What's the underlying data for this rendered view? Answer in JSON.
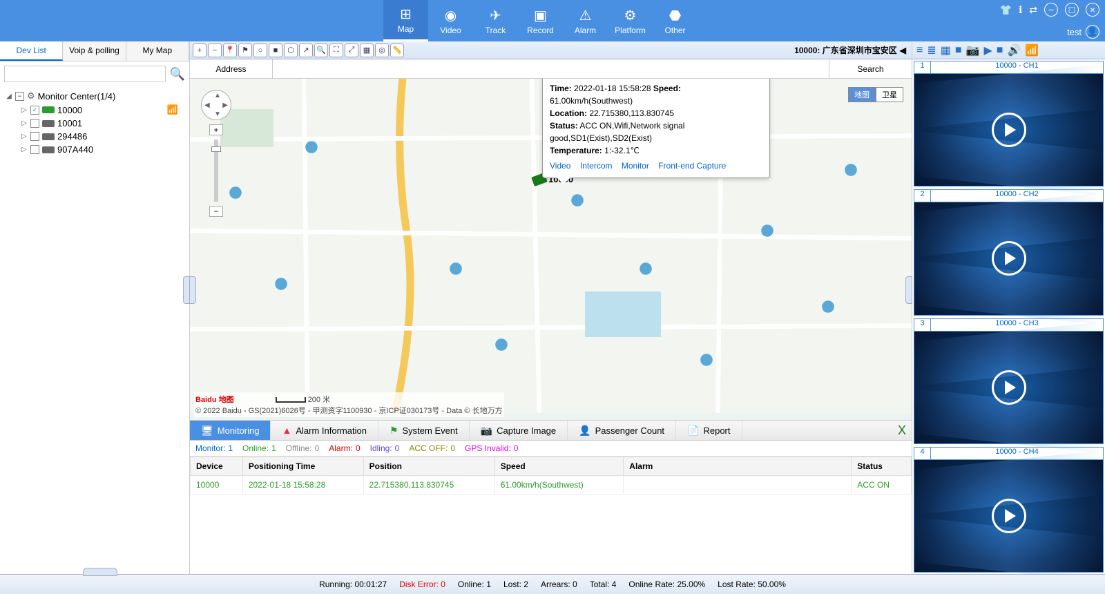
{
  "nav": {
    "tabs": [
      {
        "label": "Map",
        "active": true
      },
      {
        "label": "Video"
      },
      {
        "label": "Track"
      },
      {
        "label": "Record"
      },
      {
        "label": "Alarm"
      },
      {
        "label": "Platform"
      },
      {
        "label": "Other"
      }
    ],
    "user": "test"
  },
  "left": {
    "tabs": [
      "Dev List",
      "Voip & polling",
      "My Map"
    ],
    "activeTab": 0,
    "root": "Monitor Center(1/4)",
    "devices": [
      {
        "id": "10000",
        "online": true,
        "checked": true
      },
      {
        "id": "10001",
        "online": false,
        "checked": false
      },
      {
        "id": "294486",
        "online": false,
        "checked": false
      },
      {
        "id": "907A440",
        "online": false,
        "checked": false
      }
    ]
  },
  "toolbar": {
    "location": "10000: 广东省深圳市宝安区"
  },
  "addressBar": {
    "label": "Address",
    "search": "Search"
  },
  "map": {
    "types": {
      "map": "地图",
      "sat": "卫星"
    },
    "scale": "200 米",
    "credit": "© 2022 Baidu - GS(2021)6026号 - 甲测资字1100930 - 京ICP证030173号 - Data © 长地万方",
    "logo": "Baidu 地图",
    "vehicle": {
      "id": "10000"
    },
    "info": {
      "time_k": "Time:",
      "time_v": "2022-01-18 15:58:28",
      "speed_k": "Speed:",
      "speed_v": "61.00km/h(Southwest)",
      "location_k": "Location:",
      "location_v": "22.715380,113.830745",
      "status_k": "Status:",
      "status_v": "ACC ON,Wifi,Network signal good,SD1(Exist),SD2(Exist)",
      "temp_k": "Temperature:",
      "temp_v": "1:-32.1℃",
      "links": [
        "Video",
        "Intercom",
        "Monitor",
        "Front-end Capture"
      ]
    }
  },
  "bottom": {
    "tabs": [
      "Monitoring",
      "Alarm Information",
      "System Event",
      "Capture Image",
      "Passenger Count",
      "Report"
    ],
    "stats": {
      "monitor_k": "Monitor:",
      "monitor_v": "1",
      "online_k": "Online:",
      "online_v": "1",
      "offline_k": "Offline:",
      "offline_v": "0",
      "alarm_k": "Alarm:",
      "alarm_v": "0",
      "idling_k": "Idling:",
      "idling_v": "0",
      "accoff_k": "ACC OFF:",
      "accoff_v": "0",
      "gps_k": "GPS Invalid:",
      "gps_v": "0"
    },
    "cols": [
      "Device",
      "Positioning Time",
      "Position",
      "Speed",
      "Alarm",
      "Status"
    ],
    "row": {
      "device": "10000",
      "time": "2022-01-18 15:58:28",
      "position": "22.715380,113.830745",
      "speed": "61.00km/h(Southwest)",
      "alarm": "",
      "status": "ACC ON"
    }
  },
  "right": {
    "channels": [
      {
        "n": "1",
        "title": "10000 - CH1"
      },
      {
        "n": "2",
        "title": "10000 - CH2"
      },
      {
        "n": "3",
        "title": "10000 - CH3"
      },
      {
        "n": "4",
        "title": "10000 - CH4"
      }
    ]
  },
  "status": {
    "running_k": "Running:",
    "running_v": "00:01:27",
    "disk_k": "Disk Error:",
    "disk_v": "0",
    "online_k": "Online:",
    "online_v": "1",
    "lost_k": "Lost:",
    "lost_v": "2",
    "arrears_k": "Arrears:",
    "arrears_v": "0",
    "total_k": "Total:",
    "total_v": "4",
    "onlinerate_k": "Online Rate:",
    "onlinerate_v": "25.00%",
    "lostrate_k": "Lost Rate:",
    "lostrate_v": "50.00%"
  }
}
